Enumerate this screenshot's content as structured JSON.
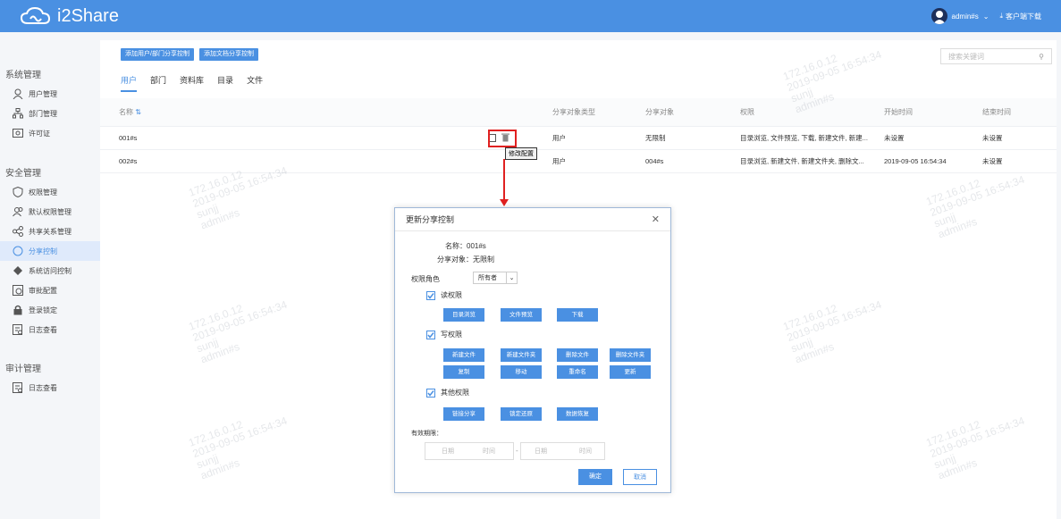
{
  "app": {
    "title": "i2Share"
  },
  "topbar": {
    "user": "admin#s",
    "download": "客户端下载"
  },
  "sidebar": {
    "groups": [
      {
        "title": "系统管理",
        "items": [
          "用户管理",
          "部门管理",
          "许可证"
        ]
      },
      {
        "title": "安全管理",
        "items": [
          "权限管理",
          "默认权限管理",
          "共享关系管理",
          "分享控制",
          "系统访问控制",
          "审批配置",
          "登录锁定",
          "日志查看"
        ]
      },
      {
        "title": "审计管理",
        "items": [
          "日志查看"
        ]
      }
    ]
  },
  "toolbar": {
    "add_share": "添加用户/部门分享控制",
    "add_doc_share": "添加文档分享控制"
  },
  "tabs": [
    "用户",
    "部门",
    "资料库",
    "目录",
    "文件"
  ],
  "search": {
    "placeholder": "搜索关键词"
  },
  "table": {
    "headers": {
      "name": "名称",
      "type": "分享对象类型",
      "obj": "分享对象",
      "perm": "权限",
      "start": "开始时间",
      "end": "结束时间"
    },
    "rows": [
      {
        "name": "001#s",
        "type": "用户",
        "obj": "无限制",
        "perm": "目录浏览, 文件预览, 下载, 新建文件, 新建...",
        "start": "未设置",
        "end": "未设置"
      },
      {
        "name": "002#s",
        "type": "用户",
        "obj": "004#s",
        "perm": "目录浏览, 新建文件, 新建文件夹, 删除文...",
        "start": "2019-09-05 16:54:34",
        "end": "未设置"
      }
    ],
    "tooltip": "修改配置"
  },
  "watermark": {
    "ip": "172.16.0.12",
    "date": "2019-09-05 16:54:34",
    "user": "sunjj",
    "admin": "admin#s"
  },
  "modal": {
    "title": "更新分享控制",
    "name_label": "名称：",
    "name_value": "001#s",
    "obj_label": "分享对象：",
    "obj_value": "无限制",
    "role_label": "权限角色",
    "role_value": "所有者",
    "read": {
      "label": "读权限",
      "buttons": [
        "目录浏览",
        "文件预览",
        "下载"
      ]
    },
    "write": {
      "label": "写权限",
      "buttons": [
        "新建文件",
        "新建文件夹",
        "删除文件",
        "删除文件夹",
        "复制",
        "移动",
        "重命名",
        "更新"
      ]
    },
    "other": {
      "label": "其他权限",
      "buttons": [
        "链接分享",
        "锁定还原",
        "数据恢复"
      ]
    },
    "validity_label": "有效期限：",
    "date_ph": "日期",
    "time_ph": "时间",
    "dash": "-",
    "confirm": "确定",
    "cancel": "取消"
  },
  "colors": {
    "accent": "#4a90e2",
    "highlight": "#e02020"
  }
}
